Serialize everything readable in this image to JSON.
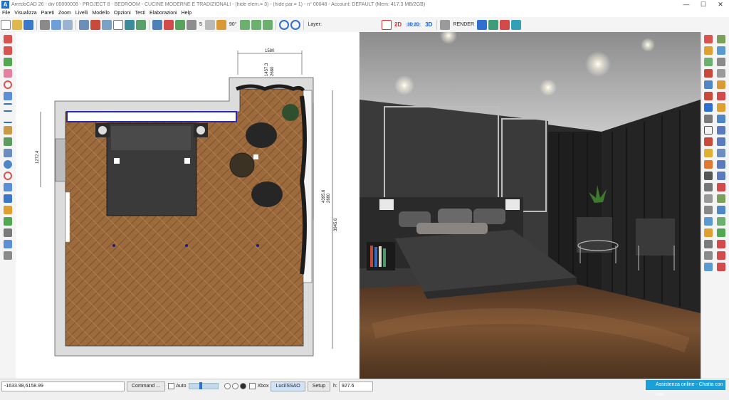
{
  "window": {
    "title": "ArredoCAD 26 - div 00000008 - PROJECT 8 - BEDROOM - CUCINE MODERNE E TRADIZIONALI - (hide elem.= 3)  - (hide par.= 1)  - n° 00048 - Account: DEFAULT             (Mem: 417.3 MB/2GB)",
    "minimize": "—",
    "maximize": "☐",
    "close": "✕"
  },
  "menu": [
    "File",
    "Visualizza",
    "Pareti",
    "Zoom",
    "Livelli",
    "Modello",
    "Opzioni",
    "Testi",
    "Elaborazioni",
    "Help"
  ],
  "toolbar": {
    "spin_value": "5",
    "angle_value": "90°",
    "layer_label": "Layer:",
    "mode_2d": "2D",
    "mode_3d2d": "3D 2D",
    "mode_3d": "3D",
    "render_label": "RENDER"
  },
  "plan": {
    "dimensions": {
      "top_width": "1580",
      "top_depth": "1457.3",
      "top_depth2": "2680",
      "left_height": "1272.4",
      "right_window": "4395.6",
      "right_window2": "2680",
      "right_height": "3945.6"
    }
  },
  "status": {
    "coordinates": "-1633.98,6158.99",
    "command_label": "Command ...",
    "auto_label": "Auto",
    "xbox_label": "Xbox",
    "luci_label": "Luci/SSAO",
    "setup_label": "Setup",
    "h_label": "h:",
    "h_value": "927.6",
    "assist_label": "Assistenza online - Chatta con noi!"
  },
  "colors": {
    "accent": "#1f5fd1",
    "wall": "#dcdcdc",
    "floor": "#9c6a3c",
    "assist": "#1aa0d8"
  }
}
